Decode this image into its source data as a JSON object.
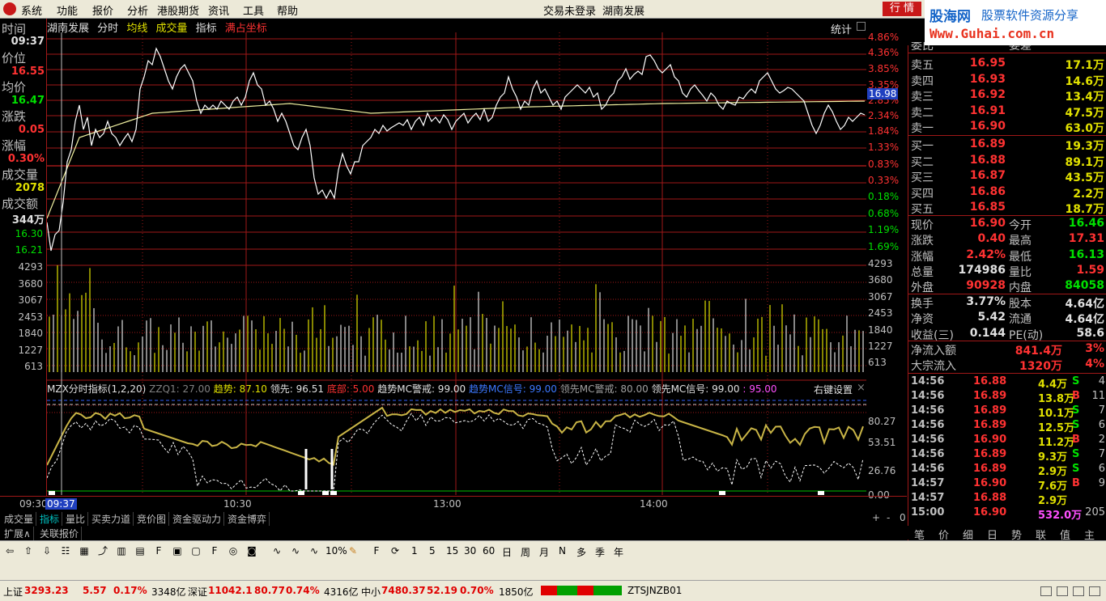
{
  "menu": {
    "items": [
      "系统",
      "功能",
      "报价",
      "分析",
      "港股期货",
      "资讯",
      "工具",
      "帮助"
    ],
    "login_status": "交易未登录",
    "stock_title": "湖南发展",
    "quote_button": "行 情"
  },
  "logo": {
    "line1a": "股海网",
    "line1b": "股票软件资源分享",
    "line2": "Www.Guhai.com.cn"
  },
  "left_panel": {
    "time_label": "时间",
    "time_value": "09:37",
    "price_label": "价位",
    "price_value": "16.55",
    "avg_label": "均价",
    "avg_value": "16.47",
    "change_label": "涨跌",
    "change_value": "0.05",
    "pct_label": "涨幅",
    "pct_value": "0.30%",
    "volume_label": "成交量",
    "volume_value": "2078",
    "amount_label": "成交额",
    "amount_value": "344万",
    "ticks": [
      "16.30",
      "16.21",
      "4293",
      "3680",
      "3067",
      "2453",
      "1840",
      "1227",
      "613"
    ]
  },
  "chart_header": {
    "stock": "湖南发展",
    "mode": "分时",
    "avg": "均线",
    "vol": "成交量",
    "ind": "指标",
    "coord": "满占坐标",
    "stats": "统计"
  },
  "right_axis": {
    "upper": [
      "4.86%",
      "4.36%",
      "3.85%",
      "3.35%",
      "2.85%",
      "2.34%",
      "1.84%",
      "1.33%",
      "0.83%",
      "0.33%",
      "0.18%",
      "0.68%",
      "1.19%",
      "1.69%"
    ],
    "price_marker": "16.98",
    "volume": [
      "4293",
      "3680",
      "3067",
      "2453",
      "1840",
      "1227",
      "613"
    ],
    "indicator": [
      "80.27",
      "53.51",
      "26.76",
      "0.00"
    ]
  },
  "indicator_header": {
    "name": "MZX分时指标(1,2,20)",
    "zzq": "ZZQ1: 27.00",
    "trend": "趋势: 87.10",
    "lead": "领先: 96.51",
    "bottom": "底部: 5.00",
    "trend_warn": "趋势MC警戒: 99.00",
    "trend_signal": "趋势MC信号: 99.00",
    "lead_warn": "领先MC警戒: 80.00",
    "lead_signal": "领先MC信号: 99.00",
    "last": ": 95.00",
    "rightkey": "右键设置",
    "close": "×"
  },
  "time_axis": {
    "start": "09:30",
    "cursor": "09:37",
    "t1": "10:30",
    "t2": "13:00",
    "t3": "14:00",
    "plus": "+",
    "minus": "-",
    "zero": "0"
  },
  "tabs1": [
    "成交量",
    "指标",
    "量比",
    "买卖力道",
    "竞价图",
    "资金驱动力",
    "资金博弈"
  ],
  "tabs2": [
    "扩展∧",
    "关联报价"
  ],
  "order_book": {
    "ask": [
      [
        "卖五",
        "16.95",
        "17.1万"
      ],
      [
        "卖四",
        "16.93",
        "14.6万"
      ],
      [
        "卖三",
        "16.92",
        "13.4万"
      ],
      [
        "卖二",
        "16.91",
        "47.5万"
      ],
      [
        "卖一",
        "16.90",
        "63.0万"
      ]
    ],
    "bid": [
      [
        "买一",
        "16.89",
        "19.3万"
      ],
      [
        "买二",
        "16.88",
        "89.1万"
      ],
      [
        "买三",
        "16.87",
        "43.5万"
      ],
      [
        "买四",
        "16.86",
        "2.2万"
      ],
      [
        "买五",
        "16.85",
        "18.7万"
      ]
    ],
    "top_partial": [
      "委比",
      "委差"
    ]
  },
  "stats": [
    [
      "现价",
      "16.90",
      "今开",
      "16.46"
    ],
    [
      "涨跌",
      "0.40",
      "最高",
      "17.31"
    ],
    [
      "涨幅",
      "2.42%",
      "最低",
      "16.13"
    ],
    [
      "总量",
      "174986",
      "量比",
      "1.59"
    ],
    [
      "外盘",
      "90928",
      "内盘",
      "84058"
    ]
  ],
  "stats2": [
    [
      "换手",
      "3.77%",
      "股本",
      "4.64亿"
    ],
    [
      "净资",
      "5.42",
      "流通",
      "4.64亿"
    ],
    [
      "收益(三)",
      "0.144",
      "PE(动)",
      "58.6"
    ]
  ],
  "flow": [
    [
      "净流入额",
      "841.4万",
      "3%"
    ],
    [
      "大宗流入",
      "1320万",
      "4%"
    ]
  ],
  "ticks_list": [
    [
      "14:56",
      "16.88",
      "4.4万",
      "S",
      "4"
    ],
    [
      "14:56",
      "16.89",
      "13.8万",
      "B",
      "11"
    ],
    [
      "14:56",
      "16.89",
      "10.1万",
      "S",
      "7"
    ],
    [
      "14:56",
      "16.89",
      "12.5万",
      "S",
      "6"
    ],
    [
      "14:56",
      "16.90",
      "11.2万",
      "B",
      "2"
    ],
    [
      "14:56",
      "16.89",
      "9.3万",
      "S",
      "7"
    ],
    [
      "14:56",
      "16.89",
      "2.9万",
      "S",
      "6"
    ],
    [
      "14:57",
      "16.90",
      "7.6万",
      "B",
      "9"
    ],
    [
      "14:57",
      "16.88",
      "2.9万",
      "",
      ""
    ],
    [
      "15:00",
      "16.90",
      "532.0万",
      "",
      "205"
    ]
  ],
  "right_tabs": [
    "笔",
    "价",
    "细",
    "日",
    "势",
    "联",
    "值",
    "主"
  ],
  "toolbar_text": [
    "10%",
    "1",
    "5",
    "15",
    "30",
    "60",
    "日",
    "周",
    "月",
    "N",
    "多",
    "季",
    "年"
  ],
  "statusbar": {
    "sh_label": "上证",
    "sh_val": "3293.23",
    "sh_chg": "5.57",
    "sh_pct": "0.17%",
    "sh_amt": "3348亿",
    "sz_label": "深证",
    "sz_val": "11042.1",
    "sz_chg": "80.77",
    "sz_pct": "0.74%",
    "sz_amt": "4316亿",
    "zx_label": "中小",
    "zx_val": "7480.37",
    "zx_chg": "52.19",
    "zx_pct": "0.70%",
    "zx_amt": "1850亿",
    "code": "ZTSJNZB01"
  },
  "colors": {
    "up": "#ff3232",
    "down": "#00e000",
    "grid": "#a01818",
    "price_line": "#ffffff",
    "avg_line": "#f0f0a0",
    "trend_line": "#c8b446"
  }
}
